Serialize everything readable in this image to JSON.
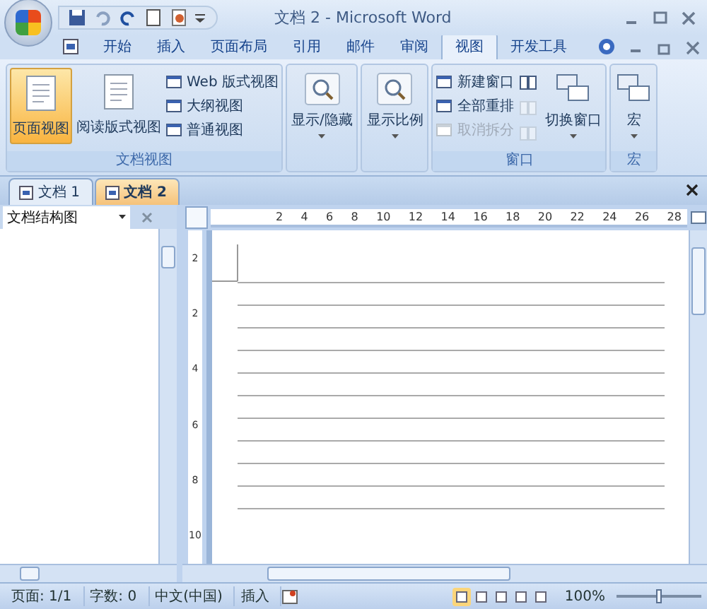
{
  "window": {
    "title": "文档 2 - Microsoft Word"
  },
  "ribbon_tabs": [
    {
      "label": "开始",
      "selected": false
    },
    {
      "label": "插入",
      "selected": false
    },
    {
      "label": "页面布局",
      "selected": false
    },
    {
      "label": "引用",
      "selected": false
    },
    {
      "label": "邮件",
      "selected": false
    },
    {
      "label": "审阅",
      "selected": false
    },
    {
      "label": "视图",
      "selected": true
    },
    {
      "label": "开发工具",
      "selected": false
    }
  ],
  "ribbon_groups": [
    {
      "title": "文档视图",
      "buttons": [
        {
          "kind": "large",
          "label": "页面视图",
          "selected": true
        },
        {
          "kind": "large",
          "label": "阅读版式视图",
          "selected": false
        },
        {
          "kind": "stack",
          "items": [
            {
              "label": "Web 版式视图",
              "disabled": false
            },
            {
              "label": "大纲视图",
              "disabled": false
            },
            {
              "label": "普通视图",
              "disabled": false
            }
          ]
        }
      ]
    },
    {
      "buttons": [
        {
          "kind": "dropdown",
          "label": "显示/隐藏"
        }
      ]
    },
    {
      "buttons": [
        {
          "kind": "dropdown",
          "label": "显示比例"
        }
      ]
    },
    {
      "title": "窗口",
      "buttons": [
        {
          "kind": "stack",
          "items": [
            {
              "label": "新建窗口",
              "disabled": false
            },
            {
              "label": "全部重排",
              "disabled": false
            },
            {
              "label": "取消拆分",
              "disabled": true
            }
          ]
        },
        {
          "kind": "icons",
          "items": [
            {
              "disabled": false
            },
            {
              "disabled": true
            },
            {
              "disabled": true
            }
          ]
        },
        {
          "kind": "dropdown",
          "label": "切换窗口"
        }
      ]
    },
    {
      "title": "宏",
      "buttons": [
        {
          "kind": "dropdown",
          "label": "宏"
        }
      ]
    }
  ],
  "document_tabs": [
    {
      "label": "文档 1",
      "selected": false
    },
    {
      "label": "文档 2",
      "selected": true
    }
  ],
  "navigation_pane": {
    "title": "文档结构图"
  },
  "horizontal_ruler": [
    "2",
    "4",
    "6",
    "8",
    "10",
    "12",
    "14",
    "16",
    "18",
    "20",
    "22",
    "24",
    "26",
    "28"
  ],
  "vertical_ruler": [
    "2",
    "2",
    "4",
    "6",
    "8",
    "10"
  ],
  "status_bar": {
    "items": [
      "页面: 1/1",
      "字数: 0",
      "中文(中国)",
      "插入"
    ],
    "view_buttons": [
      {
        "selected": true
      },
      {
        "selected": false
      },
      {
        "selected": false
      },
      {
        "selected": false
      },
      {
        "selected": false
      }
    ],
    "zoom": "100%",
    "zoom_slider": {
      "level": 0.5
    }
  }
}
